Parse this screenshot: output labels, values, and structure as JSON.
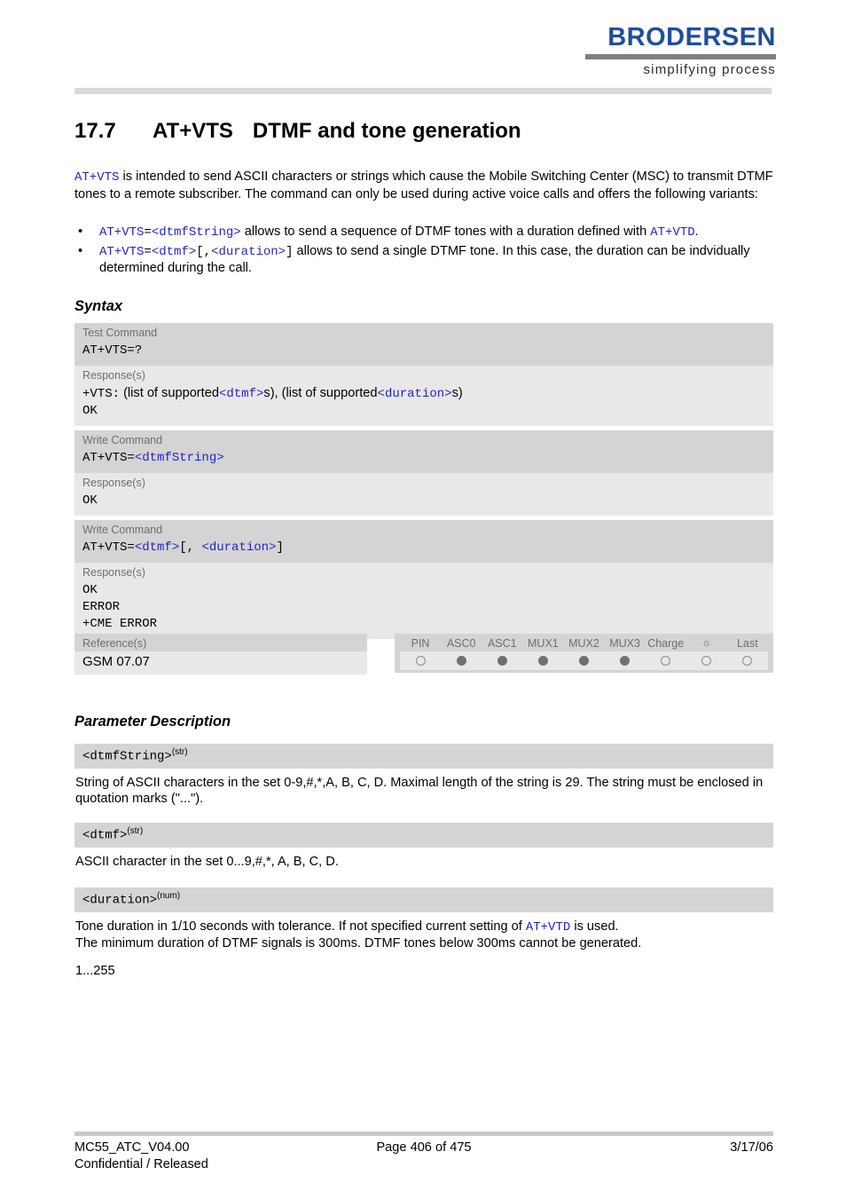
{
  "header": {
    "logo_word": "BRODERSEN",
    "logo_tagline": "simplifying process"
  },
  "title": {
    "number": "17.7",
    "command": "AT+VTS",
    "text": "DTMF and tone generation"
  },
  "intro": {
    "cmd": "AT+VTS",
    "body": " is intended to send ASCII characters or strings which cause the Mobile Switching Center (MSC) to transmit DTMF tones to a remote subscriber. The command can only be used during active voice calls and offers the following variants:"
  },
  "bullets": [
    {
      "bullet": "•",
      "cmd": "AT+VTS",
      "eq": "=",
      "param": "<dtmfString>",
      "text": " allows to send a sequence of DTMF tones with a duration defined with ",
      "ref": "AT+VTD",
      "tail": "."
    },
    {
      "bullet": "•",
      "cmd": "AT+VTS",
      "eq": "=",
      "param": "<dtmf>",
      "mid": "[,",
      "param2": "<duration>",
      "mid2": "]",
      "text": " allows to send a single DTMF tone. In this case, the duration can be indvidually determined during the call."
    }
  ],
  "sections": {
    "syntax_heading": "Syntax",
    "parameter_heading": "Parameter Description"
  },
  "syntax": {
    "groups": [
      {
        "cmd_label": "Test Command",
        "cmd_plain": "AT+VTS=?",
        "resp_label": "Response(s)",
        "resp_lines": [
          {
            "prefix": "+VTS:",
            "t1": "  (list of supported",
            "p1": "<dtmf>",
            "t2": "s), (list of supported",
            "p2": "<duration>",
            "t3": "s)"
          },
          {
            "prefix": "OK"
          }
        ]
      },
      {
        "cmd_label": "Write Command",
        "cmd_prefix": "AT+VTS=",
        "cmd_param": "<dtmfString>",
        "resp_label": "Response(s)",
        "resp_lines": [
          {
            "prefix": "OK"
          }
        ]
      },
      {
        "cmd_label": "Write Command",
        "cmd_prefix": "AT+VTS=",
        "cmd_param": "<dtmf>",
        "cmd_mid": "[, ",
        "cmd_param2": "<duration>",
        "cmd_tail": "]",
        "resp_label": "Response(s)",
        "resp_lines": [
          {
            "prefix": "OK"
          },
          {
            "prefix": "ERROR"
          },
          {
            "prefix": "+CME ERROR"
          }
        ]
      }
    ]
  },
  "reference": {
    "label": "Reference(s)",
    "value": "GSM 07.07"
  },
  "indicators": {
    "columns": [
      {
        "label": "PIN",
        "state": "off"
      },
      {
        "label": "ASC0",
        "state": "on"
      },
      {
        "label": "ASC1",
        "state": "on"
      },
      {
        "label": "MUX1",
        "state": "on"
      },
      {
        "label": "MUX2",
        "state": "on"
      },
      {
        "label": "MUX3",
        "state": "on"
      },
      {
        "label": "Charge",
        "state": "off"
      },
      {
        "label": "☼",
        "state": "off"
      },
      {
        "label": "Last",
        "state": "off"
      }
    ]
  },
  "parameters": [
    {
      "name": "<dtmfString>",
      "type": "(str)",
      "description": "String of ASCII characters in the set 0-9,#,*,A, B, C, D. Maximal length of the string is 29. The string must be enclosed in quotation marks (\"...\")."
    },
    {
      "name": "<dtmf>",
      "type": "(str)",
      "description": "ASCII character in the set 0...9,#,*, A, B, C, D."
    },
    {
      "name": "<duration>",
      "type": "(num)",
      "desc_part1": "Tone duration in 1/10 seconds with tolerance. If not specified current setting of ",
      "desc_ref": "AT+VTD",
      "desc_part2": " is used.",
      "desc_line2": "The minimum duration of DTMF signals is 300ms. DTMF tones below 300ms cannot be generated.",
      "range": "1...255"
    }
  ],
  "footer": {
    "doc": "MC55_ATC_V04.00",
    "page": "Page 406 of 475",
    "date": "3/17/06",
    "status": "Confidential / Released"
  },
  "colors": {
    "brand_blue": "#1f4e9c",
    "code_blue": "#2222cc",
    "band_dark": "#d4d4d4",
    "band_light": "#e8e8e8"
  }
}
